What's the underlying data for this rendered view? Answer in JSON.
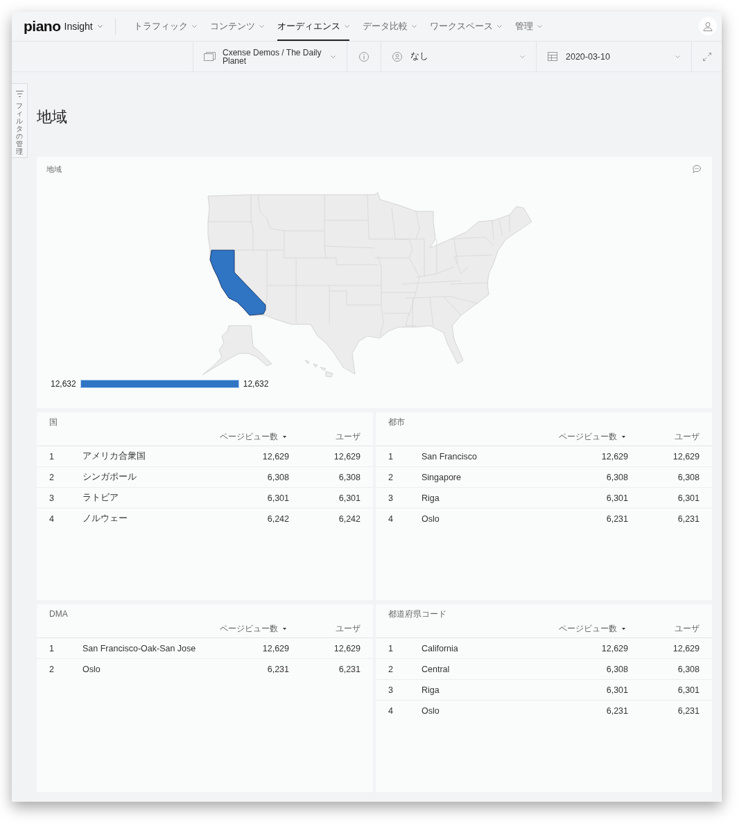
{
  "header": {
    "logo": "piano",
    "product": "Insight",
    "nav": [
      {
        "label": "トラフィック",
        "selected": false
      },
      {
        "label": "コンテンツ",
        "selected": false
      },
      {
        "label": "オーディエンス",
        "selected": true
      },
      {
        "label": "データ比較",
        "selected": false
      },
      {
        "label": "ワークスペース",
        "selected": false
      },
      {
        "label": "管理",
        "selected": false
      }
    ]
  },
  "toolbar": {
    "site": "Cxense Demos / The Daily Planet",
    "segment": "なし",
    "date": "2020-03-10"
  },
  "filter_panel": {
    "label": "フィルタの管理"
  },
  "page_title": "地域",
  "map_card": {
    "title": "地域",
    "legend": {
      "min": "12,632",
      "max": "12,632"
    }
  },
  "tables": [
    {
      "title": "国",
      "columns": [
        {
          "label": "ページビュー数",
          "sorted": true
        },
        {
          "label": "ユーザ",
          "sorted": false
        }
      ],
      "rows": [
        {
          "rank": "1",
          "name": "アメリカ合衆国",
          "values": [
            "12,629",
            "12,629"
          ]
        },
        {
          "rank": "2",
          "name": "シンガポール",
          "values": [
            "6,308",
            "6,308"
          ]
        },
        {
          "rank": "3",
          "name": "ラトビア",
          "values": [
            "6,301",
            "6,301"
          ]
        },
        {
          "rank": "4",
          "name": "ノルウェー",
          "values": [
            "6,242",
            "6,242"
          ]
        }
      ]
    },
    {
      "title": "都市",
      "columns": [
        {
          "label": "ページビュー数",
          "sorted": true
        },
        {
          "label": "ユーザ",
          "sorted": false
        }
      ],
      "rows": [
        {
          "rank": "1",
          "name": "San Francisco",
          "values": [
            "12,629",
            "12,629"
          ]
        },
        {
          "rank": "2",
          "name": "Singapore",
          "values": [
            "6,308",
            "6,308"
          ]
        },
        {
          "rank": "3",
          "name": "Riga",
          "values": [
            "6,301",
            "6,301"
          ]
        },
        {
          "rank": "4",
          "name": "Oslo",
          "values": [
            "6,231",
            "6,231"
          ]
        }
      ]
    },
    {
      "title": "DMA",
      "columns": [
        {
          "label": "ページビュー数",
          "sorted": true
        },
        {
          "label": "ユーザ",
          "sorted": false
        }
      ],
      "rows": [
        {
          "rank": "1",
          "name": "San Francisco-Oak-San Jose",
          "values": [
            "12,629",
            "12,629"
          ]
        },
        {
          "rank": "2",
          "name": "Oslo",
          "values": [
            "6,231",
            "6,231"
          ]
        }
      ]
    },
    {
      "title": "都道府県コード",
      "columns": [
        {
          "label": "ページビュー数",
          "sorted": true
        },
        {
          "label": "ユーザ",
          "sorted": false
        }
      ],
      "rows": [
        {
          "rank": "1",
          "name": "California",
          "values": [
            "12,629",
            "12,629"
          ]
        },
        {
          "rank": "2",
          "name": "Central",
          "values": [
            "6,308",
            "6,308"
          ]
        },
        {
          "rank": "3",
          "name": "Riga",
          "values": [
            "6,301",
            "6,301"
          ]
        },
        {
          "rank": "4",
          "name": "Oslo",
          "values": [
            "6,231",
            "6,231"
          ]
        }
      ]
    }
  ]
}
